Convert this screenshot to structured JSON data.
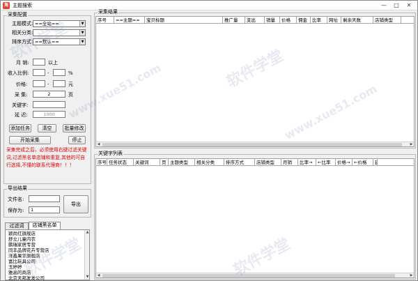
{
  "window": {
    "title": "主题搜索",
    "app_icon": "淘",
    "controls": [
      "—",
      "□",
      "✕"
    ]
  },
  "config": {
    "group_title": "采集配置",
    "theme_label": "主题模式:",
    "theme_value": "==全站==",
    "category_label": "相关分类:",
    "category_value": "",
    "sort_label": "排序方式:",
    "sort_value": "==默认==",
    "monthly_label": "月  销:",
    "monthly_value": "",
    "monthly_suffix": "以上",
    "ratio_label": "收入比例:",
    "ratio_from": "",
    "ratio_dash": "-",
    "ratio_to": "",
    "ratio_unit": "%",
    "price_label": "价格:",
    "price_from": "",
    "price_dash": "-",
    "price_to": "",
    "price_unit": "元",
    "collect_label": "采  集:",
    "collect_value": "2",
    "collect_unit": "页",
    "keyword_label": "关键字:",
    "keyword_value": "",
    "delay_label": "延  迟:",
    "delay_value": "1000"
  },
  "buttons": {
    "add_task": "添加任务",
    "clear": "清空",
    "batch_edit": "批量修改",
    "start": "开始采集",
    "stop": "停止",
    "export": "导出"
  },
  "warning_text": "采集完成之后，必须使用右键过滤关键词,过滤黑名单店铺和重复,其他的可自行选择,不懂的联系代理商！！！",
  "export": {
    "group_title": "导出结果",
    "filename_label": "文件名:",
    "filename_value": "",
    "saveas_label": "保存为:",
    "saveas_value": "1"
  },
  "tabs": [
    {
      "label": "过滤词",
      "active": false
    },
    {
      "label": "店铺黑名单",
      "active": true
    }
  ],
  "blacklist": [
    "颖尚红旗舰店",
    "舒立儿童内衣",
    "鹏瑞家居专营",
    "同丰品牌花卉专营店",
    "洋鑫果华旗舰店",
    "富比玩具公司",
    "玉婷婷",
    "雅高的商店",
    "北京天邦发发公司"
  ],
  "results": {
    "group_title": "采集结果",
    "columns": [
      "序号",
      "==主题==",
      "宝贝标题",
      "推广量",
      "支出",
      "销量",
      "价格",
      "佣金",
      "比率",
      "网址",
      "剩余天数",
      "店铺类型"
    ]
  },
  "keywords": {
    "group_title": "关键字列表",
    "columns": [
      "序号",
      "任务状态",
      "关键词",
      "页",
      "主题类型",
      "相关分类",
      "排序方式",
      "店铺类型",
      "月销",
      "比率→",
      "←比率",
      "价格→",
      "←价格",
      "延"
    ]
  },
  "watermarks": [
    "软件学堂",
    "www.xue51.com",
    "软件学堂",
    "www.xue51.com",
    "软件学堂",
    "软件学堂"
  ]
}
